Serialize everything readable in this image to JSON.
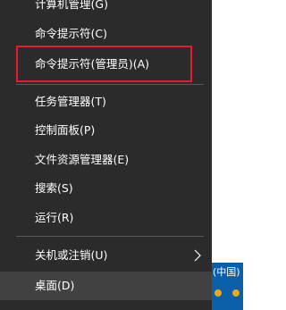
{
  "menu": {
    "items": [
      {
        "label": "计算机管理(G)"
      },
      {
        "label": "命令提示符(C)"
      },
      {
        "label": "命令提示符(管理员)(A)"
      },
      {
        "label": "任务管理器(T)"
      },
      {
        "label": "控制面板(P)"
      },
      {
        "label": "文件资源管理器(E)"
      },
      {
        "label": "搜索(S)"
      },
      {
        "label": "运行(R)"
      },
      {
        "label": "关机或注销(U)",
        "submenu_icon": "chevron-right-icon"
      },
      {
        "label": "桌面(D)"
      }
    ]
  },
  "taskbar": {
    "language_text": "(中国)",
    "tray_icons": [
      "tray-icon",
      "tray-icon"
    ]
  },
  "colors": {
    "menu_bg": "#2b2b2b",
    "active_bg": "#414141",
    "highlight_border": "#e11d2a",
    "taskbar_bg": "#0a5fa8"
  }
}
